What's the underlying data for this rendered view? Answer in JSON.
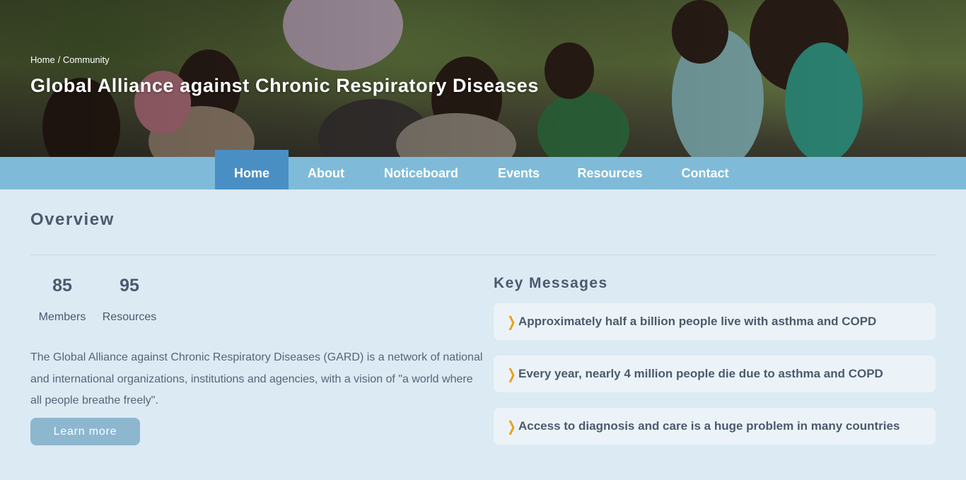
{
  "hero": {
    "breadcrumb": [
      "Home",
      "/ Community"
    ],
    "title": "Global Alliance against Chronic Respiratory Diseases"
  },
  "nav": {
    "items": [
      "Home",
      "About",
      "Noticeboard",
      "Events",
      "Resources",
      "Contact"
    ],
    "active": "Home"
  },
  "overview": {
    "title": "Overview",
    "stats": [
      {
        "value": "85",
        "label": "Members"
      },
      {
        "value": "95",
        "label": "Resources"
      }
    ],
    "description": "The Global Alliance against Chronic Respiratory Diseases (GARD) is a network of national and international organizations, institutions and agencies, with a vision of \"a world where all people breathe freely\".",
    "learn_more": "Learn more"
  },
  "key_messages": {
    "title": "Key Messages",
    "items": [
      "Approximately half a billion people live with asthma and COPD",
      "Every year, nearly 4 million people die due to asthma and COPD",
      "Access to diagnosis and care is a huge problem in many countries"
    ]
  },
  "colors": {
    "background": "#dceaf3",
    "nav": "#7fbbd9",
    "nav_active": "#4a8fc4",
    "button": "#8db7cf",
    "accent_chevron": "#e8a11a",
    "text": "#4a5a6e"
  },
  "icons": {
    "key_message_bullet": "chevron-right-icon"
  }
}
